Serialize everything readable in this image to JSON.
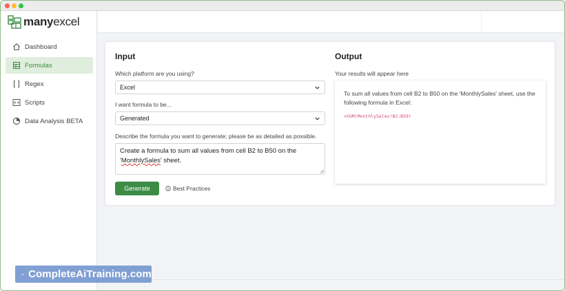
{
  "app": {
    "logo_bold": "many",
    "logo_rest": "excel"
  },
  "sidebar": {
    "items": [
      {
        "label": "Dashboard",
        "icon": "home-icon"
      },
      {
        "label": "Formulas",
        "icon": "spreadsheet-icon",
        "active": true
      },
      {
        "label": "Regex",
        "icon": "brackets-icon"
      },
      {
        "label": "Scripts",
        "icon": "code-icon"
      },
      {
        "label": "Data Analysis BETA",
        "icon": "pie-chart-icon"
      }
    ]
  },
  "input": {
    "heading": "Input",
    "platform_label": "Which platform are you using?",
    "platform_value": "Excel",
    "mode_label": "I want formula to be...",
    "mode_value": "Generated",
    "describe_label": "Describe the formula you want to generate; please be as detailed as possible.",
    "describe_text_1": "Create a formula to sum all values from cell B2 to B50 on the '",
    "describe_text_sq": "MonthlySales",
    "describe_text_2": "' sheet.",
    "generate_label": "Generate",
    "best_practices_label": "Best Practices"
  },
  "output": {
    "heading": "Output",
    "subheading": "Your results will appear here",
    "result_text": "To sum all values from cell B2 to B50 on the 'MonthlySales' sheet, use the following formula in Excel:",
    "formula": "=SUM(MonthlySales!B2:B50)"
  },
  "watermark": {
    "text": "CompleteAiTraining.com"
  },
  "colors": {
    "accent": "#3c8c46",
    "active_bg": "#dfeedd",
    "formula": "#d04a6e",
    "watermark_bg": "#7093cd"
  }
}
